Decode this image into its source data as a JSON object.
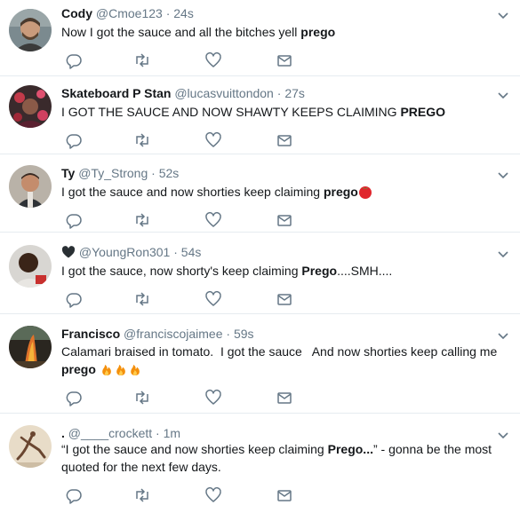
{
  "tweets": [
    {
      "name": "Cody",
      "handle": "@Cmoe123",
      "separator": "·",
      "time": "24s",
      "text_before": "Now I got the sauce and all the bitches yell ",
      "text_bold": "prego",
      "text_after": "",
      "avatar_icon": "avatar-photo"
    },
    {
      "name": "Skateboard P Stan",
      "handle": "@lucasvuittondon",
      "separator": "·",
      "time": "27s",
      "text_before": "I GOT THE SAUCE AND NOW SHAWTY KEEPS CLAIMING ",
      "text_bold": "PREGO",
      "text_after": "",
      "avatar_icon": "avatar-photo"
    },
    {
      "name": "Ty",
      "handle": "@Ty_Strong",
      "separator": "·",
      "time": "52s",
      "text_before": "I got the sauce and now shorties keep claiming ",
      "text_bold": "prego",
      "text_after": "",
      "emoji": "tomato-emoji",
      "avatar_icon": "avatar-photo"
    },
    {
      "name": "",
      "name_icon": "black-heart-icon",
      "handle": "@YoungRon301",
      "separator": "·",
      "time": "54s",
      "text_before": "I got the sauce, now shorty's keep claiming ",
      "text_bold": "Prego",
      "text_after": "....SMH....",
      "avatar_icon": "avatar-photo"
    },
    {
      "name": "Francisco",
      "handle": "@franciscojaimee",
      "separator": "·",
      "time": "59s",
      "text_line1": "Calamari braised in tomato.  I got the sauce   And now shorties keep calling me",
      "text_bold": "prego",
      "emoji": "fire-emoji",
      "avatar_icon": "avatar-photo"
    },
    {
      "name": ".",
      "handle": "@____crockett",
      "separator": "·",
      "time": "1m",
      "text_before": "“I got the sauce and now shorties keep claiming ",
      "text_bold": "Prego...",
      "text_after": "” - gonna be the most",
      "text_line2": "quoted for the next few days.",
      "avatar_icon": "avatar-photo"
    }
  ],
  "actions": [
    "reply-icon",
    "retweet-icon",
    "like-icon",
    "message-icon"
  ],
  "colors": {
    "text": "#14171a",
    "secondary": "#657786",
    "border": "#e6ecf0",
    "tomato": "#e0262d",
    "fire": "#f4900c"
  }
}
